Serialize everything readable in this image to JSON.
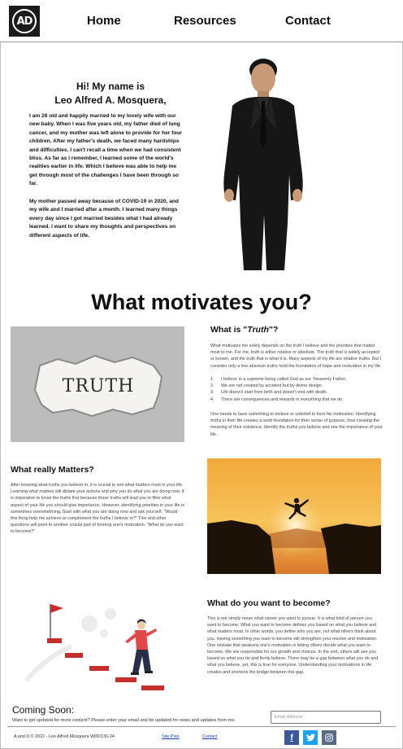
{
  "header": {
    "logo_text": "AD",
    "nav": [
      "Home",
      "Resources",
      "Contact"
    ]
  },
  "intro": {
    "title_line1": "Hi! My name is",
    "title_line2": "Leo Alfred A. Mosquera,",
    "paragraph1": "I am 28 old and happily married to my lovely wife with our new baby. When I was five years old, my father died of lung cancer, and my mother was left alone to provide for her four children. After my father's death, we faced many hardships and difficulties. I can't recall a time when we had consistent bliss. As far as I remember, I learned some of the world's realities earlier in life. Which I believe was able to help me get through most of the challenges I have been through so far.",
    "paragraph2": "My mother passed away because of COVID-19 in 2020, and my wife and I married after a month. I learned many things every day since I got married besides what I had already learned. I want to share my thoughts and perspectives on different aspects of life."
  },
  "motivates": {
    "heading": "What motivates you?"
  },
  "truth": {
    "image_word": "TRUTH",
    "title_prefix": "What is \"",
    "title_emph": "Truth",
    "title_suffix": "\"?",
    "text1": "What motivates me solely depends on the truth I believe and the priorities that matter most to me. For me, truth is either relative or absolute. The truth that is widely accepted or known, and the truth that is what it is. Many aspects of my life are relative truths. But I consider only a few absolute truths hold the foundation of hope and motivation in my life.",
    "list": [
      {
        "num": "1.",
        "text": "I believe in a supreme being called God as our 'Heavenly Father."
      },
      {
        "num": "2.",
        "text": "We are not created by accident but by divine design."
      },
      {
        "num": "3.",
        "text": "Life doesn't start from birth and doesn't end with death."
      },
      {
        "num": "4.",
        "text": "There are consequences and rewards in everything that we do."
      }
    ],
    "text2": "One needs to have something to believe or unbelief to form his motivation. Identifying truths in their life creates a solid foundation for their sense of purpose, thus creating the meaning of their existence. Identify the truths you believe and see the importance of your life."
  },
  "matters": {
    "title": "What really Matters?",
    "text": "After knowing what truths you believe in, it is crucial to see what matters most in your life. Learning what matters will dictate your actions and why you do what you are doing now. It is imperative to know the truths first because those truths will lead you to filter what aspect of your life you should give importance. However, identifying priorities in your life is sometimes overwhelming. Start with what you are doing now and ask yourself, \"Would this thing help me achieve or complement the truths I believe in?\" This and other questions will point to another crucial part of forming one's motivation: \"What do you want to become?\""
  },
  "become": {
    "title": "What do you want to become?",
    "text": "This is not simply mean what career you want to pursue. It is what kind of person you want to become. What you want to become defines you based on what you believe and what matters most. In other words, you define who you are, not what others think about you. Having something you want to become will strengthen your resolve and motivation. One mistake that weakens one's motivation is letting others decide what you want to become. We are responsible for our growth and choices. In the end, others will see you based on what you do and firmly believe. There may be a gap between what you do and what you believe, yet, this is true for everyone. Understanding your motivations in life creates and shortens the bridge between this gap."
  },
  "footer": {
    "coming_title": "Coming Soon:",
    "coming_text": "Want to get updated for more content? Please enter your email and be updated for news and updates from me.",
    "email_placeholder": "Email Address",
    "copyright": "A and D © 2022 - Leo Alfred Mosquera WDD130-24",
    "link_site_plan": "Site Plan",
    "link_contact": "Contact",
    "social": [
      "f",
      "t",
      "ig"
    ]
  },
  "colors": {
    "facebook": "#3b5998",
    "twitter": "#1da1f2",
    "instagram": "#5a6b86",
    "link": "#1a3fbf"
  }
}
